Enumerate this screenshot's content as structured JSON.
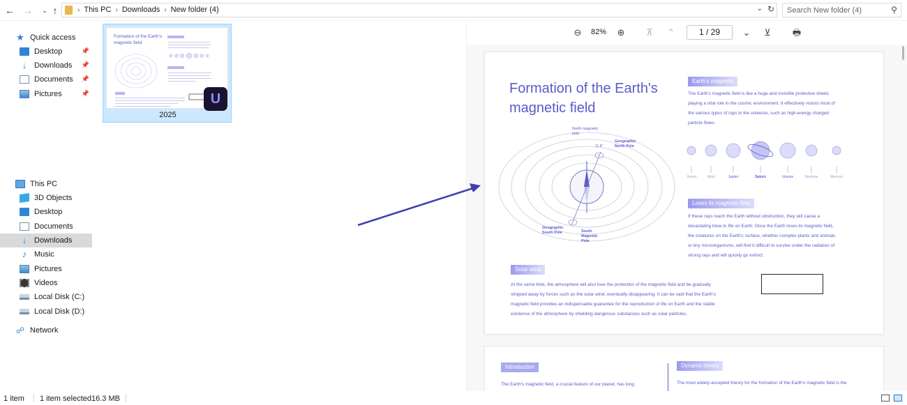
{
  "address": {
    "crumbs": [
      "This PC",
      "Downloads",
      "New folder (4)"
    ],
    "search_placeholder": "Search New folder (4)"
  },
  "nav": {
    "quick_access": "Quick access",
    "quick_items": [
      {
        "label": "Desktop",
        "icon": "desktop-icon"
      },
      {
        "label": "Downloads",
        "icon": "download-arrow-icon"
      },
      {
        "label": "Documents",
        "icon": "documents-icon"
      },
      {
        "label": "Pictures",
        "icon": "pictures-icon"
      }
    ],
    "this_pc": "This PC",
    "pc_items": [
      {
        "label": "3D Objects",
        "icon": "3d-objects-icon"
      },
      {
        "label": "Desktop",
        "icon": "desktop-icon"
      },
      {
        "label": "Documents",
        "icon": "documents-icon"
      },
      {
        "label": "Downloads",
        "icon": "download-arrow-icon",
        "selected": true
      },
      {
        "label": "Music",
        "icon": "music-note-icon"
      },
      {
        "label": "Pictures",
        "icon": "pictures-icon"
      },
      {
        "label": "Videos",
        "icon": "video-film-icon"
      },
      {
        "label": "Local Disk (C:)",
        "icon": "drive-icon"
      },
      {
        "label": "Local Disk (D:)",
        "icon": "drive-icon"
      }
    ],
    "network": "Network"
  },
  "file": {
    "name": "2025",
    "thumb_title": "Formation of the Earth's magnetic field"
  },
  "preview": {
    "zoom": "82%",
    "page_current": "1",
    "page_total": "29",
    "page_display": "1 / 29",
    "doc": {
      "title": "Formation of the Earth's magnetic field",
      "tag_magnetic": "Earth's magnetic",
      "para_magnetic": [
        "The Earth's magnetic field is like a huge and invisible protective shield,",
        "playing a vital role in the cosmic environment. It effectively resists most of",
        "the various types of rays in the universe, such as high-energy charged",
        "particle flows."
      ],
      "planets": [
        "Venus",
        "Mars",
        "Jupiter",
        "Saturn",
        "Uranus",
        "Neptune",
        "Mercury"
      ],
      "diagram_labels": {
        "north_magnetic": "North magnetic pole",
        "geo_north": "Geographic North Pole",
        "geo_south": "Geographic South Pole",
        "south_magnetic": "South Magnetic Pole",
        "angle": "11.5°"
      },
      "tag_loses": "Loses its magnetic field",
      "para_loses": [
        "If these rays reach the Earth without obstruction, they will cause a",
        "devastating blow to life on Earth. Once the Earth loses its magnetic field,",
        "the creatures on the Earth's surface, whether complex plants and animals",
        "or tiny microorganisms, will find it difficult to survive under the radiation of",
        "strong rays and will quickly go extinct."
      ],
      "tag_solar": "Solar wind",
      "para_solar": [
        "At the same time, the atmosphere will also lose the protection of the magnetic field and be gradually",
        "stripped away by forces such as the solar wind, eventually disappearing. It can be said that the Earth's",
        "magnetic field provides an indispensable guarantee for the reproduction of life on Earth and the stable",
        "existence of the atmosphere by shielding dangerous substances such as solar particles."
      ],
      "tag_intro": "Introduction",
      "para_intro": "The Earth's magnetic field, a crucial feature of our planet, has long",
      "tag_dynamo": "Dynamo theory",
      "para_dynamo": "The most widely-accepted theory for the formation of the Earth's magnetic field is the"
    }
  },
  "status": {
    "count": "1 item",
    "selected": "1 item selected",
    "size": "16.3 MB"
  },
  "colors": {
    "accent": "#5a5acb",
    "selection": "#cce8ff",
    "arrow": "#3b3fb0"
  }
}
